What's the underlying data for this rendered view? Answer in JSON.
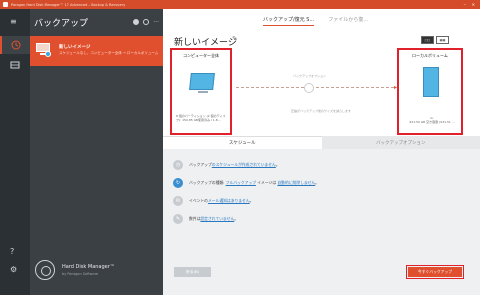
{
  "window": {
    "title": "Paragon Hard Disk Manager™ 17 Advanced – Backup & Recovery"
  },
  "leftbar": {
    "menu_icon": "hamburger-icon",
    "nav": [
      {
        "icon": "clock-icon",
        "active": true
      },
      {
        "icon": "drive-icon",
        "active": false
      }
    ],
    "help_icon": "help-icon",
    "settings_icon": "gear-icon"
  },
  "sidepanel": {
    "title": "バックアップ",
    "item": {
      "name": "新しいイメージ",
      "desc": "スケジュールなし、コンピューター全体 → ローカルボリューム"
    },
    "brand": {
      "name": "Hard Disk Manager™",
      "vendor": "by Paragon Software"
    }
  },
  "main": {
    "tabs": [
      "バックアップ/復元 S...",
      "ファイルから復..."
    ],
    "heading": "新しいイメージ",
    "view_buttons": [
      "□□",
      "▦▦"
    ],
    "source": {
      "label": "コンピューター全体",
      "info": "8 個のパーティション (2 個のディスク): 150.85 GB使用済み / 1.8..."
    },
    "arrow_note_top": "バックアップオプション",
    "arrow_note_bottom": "圧縮がバックアップ後のサイズを減らします",
    "dest": {
      "label": "ローカルボリューム",
      "info": "G:\n931.50 GB 空き容量 (931.51 ..."
    },
    "section_tabs": [
      "スケジュール",
      "バックアップオプション"
    ],
    "options": [
      {
        "icon": "clock-icon",
        "pre": "バックアップ",
        "link": "のスケジュールが作成されていません",
        "post": "。"
      },
      {
        "icon": "refresh-icon",
        "pre": "バックアップの種類: ",
        "link": "フルバックアップ",
        "mid": " イメージは ",
        "link2": "自動的に削除しません",
        "post": "。"
      },
      {
        "icon": "mail-icon",
        "pre": "イベントの",
        "link": "メール通知はありません",
        "post": "。"
      },
      {
        "icon": "comment-icon",
        "pre": "数件は",
        "link": "設定されていません",
        "post": "。"
      }
    ],
    "back_label": "戻る(B)",
    "start_label": "今すぐバックアップ"
  }
}
